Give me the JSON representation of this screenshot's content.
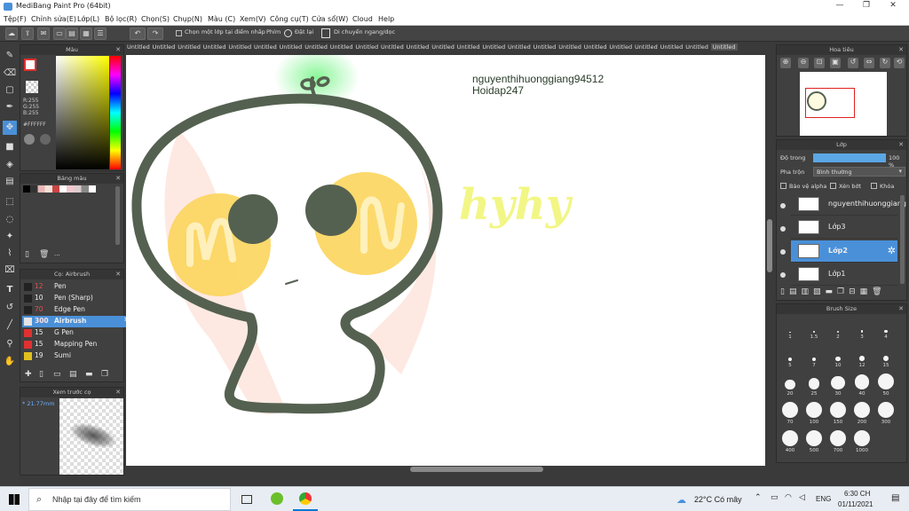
{
  "window": {
    "title": "MediBang Paint Pro (64bit)",
    "minimize": "—",
    "maximize": "❐",
    "close": "✕"
  },
  "menu": [
    "Tệp(F)",
    "Chỉnh sửa(E)",
    "Lớp(L)",
    "Bộ lọc(R)",
    "Chọn(S)",
    "Chụp(N)",
    "Màu (C)",
    "Xem(V)",
    "Công cụ(T)",
    "Cửa sổ(W)",
    "Cloud",
    "Help"
  ],
  "toolbar": {
    "select_layer_label": "Chọn một lớp tại điểm nhấp",
    "key_label": "Phím",
    "reset_label": "Đặt lại",
    "flip_label": "Di chuyển ngang/dọc"
  },
  "tabs": [
    "Untitled",
    "Untitled",
    "Untitled",
    "Untitled",
    "Untitled",
    "Untitled",
    "Untitled",
    "Untitled",
    "Untitled",
    "Untitled",
    "Untitled",
    "Untitled",
    "Untitled",
    "Untitled",
    "Untitled",
    "Untitled",
    "Untitled",
    "Untitled",
    "Untitled",
    "Untitled",
    "Untitled",
    "Untitled",
    "Untitled",
    "Untitled"
  ],
  "color_panel": {
    "title": "Màu",
    "r": "R:255",
    "g": "G:255",
    "b": "B:255",
    "hex": "#FFFFFF"
  },
  "palette_panel": {
    "title": "Bảng màu",
    "more": "···"
  },
  "brush_panel": {
    "title": "Cọ: Airbrush",
    "brushes": [
      {
        "size": "12",
        "name": "Pen",
        "color": "#222222"
      },
      {
        "size": "10",
        "name": "Pen (Sharp)",
        "color": "#222222"
      },
      {
        "size": "70",
        "name": "Edge Pen",
        "color": "#222222"
      },
      {
        "size": "300",
        "name": "Airbrush",
        "color": "#e5e5e5"
      },
      {
        "size": "15",
        "name": "G Pen",
        "color": "#e03030"
      },
      {
        "size": "15",
        "name": "Mapping Pen",
        "color": "#e03030"
      },
      {
        "size": "19",
        "name": "Sumi",
        "color": "#e0c020"
      }
    ]
  },
  "preview_panel": {
    "title": "Xem trước cọ",
    "size": "* 21.77mm"
  },
  "navigator_panel": {
    "title": "Hoa tiêu"
  },
  "layer_panel": {
    "title": "Lớp",
    "opacity_label": "Độ trong",
    "opacity_value": "100 %",
    "opacity_fraction": 1.0,
    "blend_label": "Pha trộn",
    "blend_value": "Bình thường",
    "protect_alpha": "Bảo vệ alpha",
    "clipping": "Xén bớt",
    "lock": "Khóa",
    "layers": [
      "nguyenthihuonggiang",
      "Lớp3",
      "Lớp2",
      "Lớp1"
    ]
  },
  "brush_size_panel": {
    "title": "Brush Size",
    "sizes": [
      "1",
      "1.5",
      "2",
      "3",
      "4",
      "5",
      "7",
      "10",
      "12",
      "15",
      "20",
      "25",
      "30",
      "40",
      "50",
      "70",
      "100",
      "150",
      "200",
      "300",
      "400",
      "500",
      "700",
      "1000"
    ]
  },
  "canvas_text": {
    "line1": "nguyenthihuonggiang94512",
    "line2": "Hoidap247",
    "scribble": "hyhy"
  },
  "taskbar": {
    "search": "Nhập tại đây để tìm kiếm",
    "weather": "22°C Có mây",
    "lang": "ENG",
    "time": "6:30 CH",
    "date": "01/11/2021"
  },
  "colors": {
    "accent": "#4a90d9",
    "outline": "#556150",
    "cheek": "#fcd55c",
    "sprout": "#40d060",
    "highlighter": "#f0f570"
  }
}
